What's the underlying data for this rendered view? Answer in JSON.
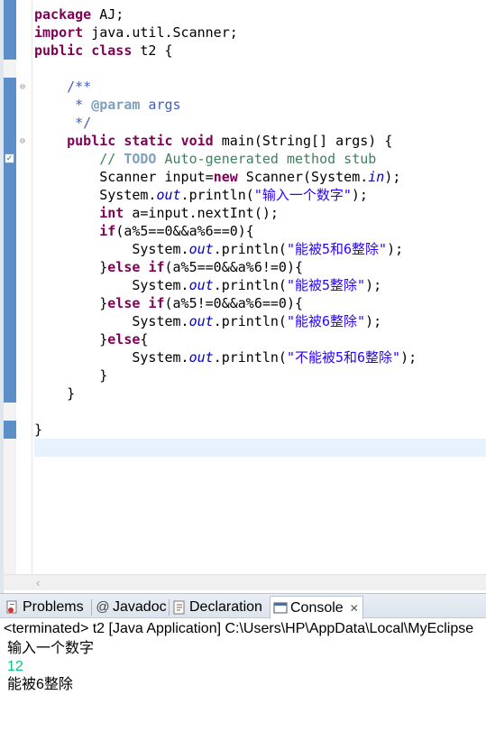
{
  "editor": {
    "code_lines": [
      [
        {
          "t": "package",
          "c": "kw"
        },
        {
          "t": " AJ;"
        }
      ],
      [
        {
          "t": "import",
          "c": "kw"
        },
        {
          "t": " java.util.Scanner;"
        }
      ],
      [
        {
          "t": "public",
          "c": "kw"
        },
        {
          "t": " "
        },
        {
          "t": "class",
          "c": "kw"
        },
        {
          "t": " t2 {"
        }
      ],
      [],
      [
        {
          "t": "    /**",
          "c": "jd"
        }
      ],
      [
        {
          "t": "     * ",
          "c": "jd"
        },
        {
          "t": "@param",
          "c": "jdtag"
        },
        {
          "t": " args",
          "c": "jd"
        }
      ],
      [
        {
          "t": "     */",
          "c": "jd"
        }
      ],
      [
        {
          "t": "    "
        },
        {
          "t": "public",
          "c": "kw"
        },
        {
          "t": " "
        },
        {
          "t": "static",
          "c": "kw"
        },
        {
          "t": " "
        },
        {
          "t": "void",
          "c": "kw"
        },
        {
          "t": " main(String[] args) {"
        }
      ],
      [
        {
          "t": "        "
        },
        {
          "t": "// ",
          "c": "cm"
        },
        {
          "t": "TODO",
          "c": "todo"
        },
        {
          "t": " Auto-generated method stub",
          "c": "cm"
        }
      ],
      [
        {
          "t": "        Scanner input="
        },
        {
          "t": "new",
          "c": "kw"
        },
        {
          "t": " Scanner(System."
        },
        {
          "t": "in",
          "c": "fd"
        },
        {
          "t": ");"
        }
      ],
      [
        {
          "t": "        System."
        },
        {
          "t": "out",
          "c": "fd"
        },
        {
          "t": ".println("
        },
        {
          "t": "\"输入一个数字\"",
          "c": "st"
        },
        {
          "t": ");"
        }
      ],
      [
        {
          "t": "        "
        },
        {
          "t": "int",
          "c": "kw"
        },
        {
          "t": " a=input.nextInt();"
        }
      ],
      [
        {
          "t": "        "
        },
        {
          "t": "if",
          "c": "kw"
        },
        {
          "t": "(a%5==0&&a%6==0){"
        }
      ],
      [
        {
          "t": "            System."
        },
        {
          "t": "out",
          "c": "fd"
        },
        {
          "t": ".println("
        },
        {
          "t": "\"能被5和6整除\"",
          "c": "st"
        },
        {
          "t": ");"
        }
      ],
      [
        {
          "t": "        }"
        },
        {
          "t": "else",
          "c": "kw"
        },
        {
          "t": " "
        },
        {
          "t": "if",
          "c": "kw"
        },
        {
          "t": "(a%5==0&&a%6!=0){"
        }
      ],
      [
        {
          "t": "            System."
        },
        {
          "t": "out",
          "c": "fd"
        },
        {
          "t": ".println("
        },
        {
          "t": "\"能被5整除\"",
          "c": "st"
        },
        {
          "t": ");"
        }
      ],
      [
        {
          "t": "        }"
        },
        {
          "t": "else",
          "c": "kw"
        },
        {
          "t": " "
        },
        {
          "t": "if",
          "c": "kw"
        },
        {
          "t": "(a%5!=0&&a%6==0){"
        }
      ],
      [
        {
          "t": "            System."
        },
        {
          "t": "out",
          "c": "fd"
        },
        {
          "t": ".println("
        },
        {
          "t": "\"能被6整除\"",
          "c": "st"
        },
        {
          "t": ");"
        }
      ],
      [
        {
          "t": "        }"
        },
        {
          "t": "else",
          "c": "kw"
        },
        {
          "t": "{"
        }
      ],
      [
        {
          "t": "            System."
        },
        {
          "t": "out",
          "c": "fd"
        },
        {
          "t": ".println("
        },
        {
          "t": "\"不能被5和6整除\"",
          "c": "st"
        },
        {
          "t": ");"
        }
      ],
      [
        {
          "t": "        }"
        }
      ],
      [
        {
          "t": "    }"
        }
      ],
      [],
      [
        {
          "t": "}"
        }
      ],
      []
    ],
    "current_line_index": 24,
    "fold_markers": [
      "⊖",
      "⊖"
    ],
    "task_marker_icon": "task-checkbox-icon"
  },
  "views": {
    "tabs": [
      {
        "label": "Problems",
        "icon": "problems-icon"
      },
      {
        "label": "Javadoc",
        "icon": "at-icon"
      },
      {
        "label": "Declaration",
        "icon": "declaration-icon"
      },
      {
        "label": "Console",
        "icon": "console-icon",
        "close": "✕"
      }
    ]
  },
  "console": {
    "header": "<terminated> t2 [Java Application] C:\\Users\\HP\\AppData\\Local\\MyEclipse",
    "output": [
      {
        "text": "输入一个数字",
        "kind": "out"
      },
      {
        "text": "12",
        "kind": "in"
      },
      {
        "text": "能被6整除",
        "kind": "out"
      }
    ]
  },
  "colors": {
    "keyword": "#7f0055",
    "comment": "#3f7f5f",
    "javadoc": "#3f5fbf",
    "string": "#2a00ff",
    "field": "#0000c0",
    "user_input": "#00c87d",
    "current_line": "#e8f2fe",
    "ruler_change": "#5c8ec7"
  }
}
